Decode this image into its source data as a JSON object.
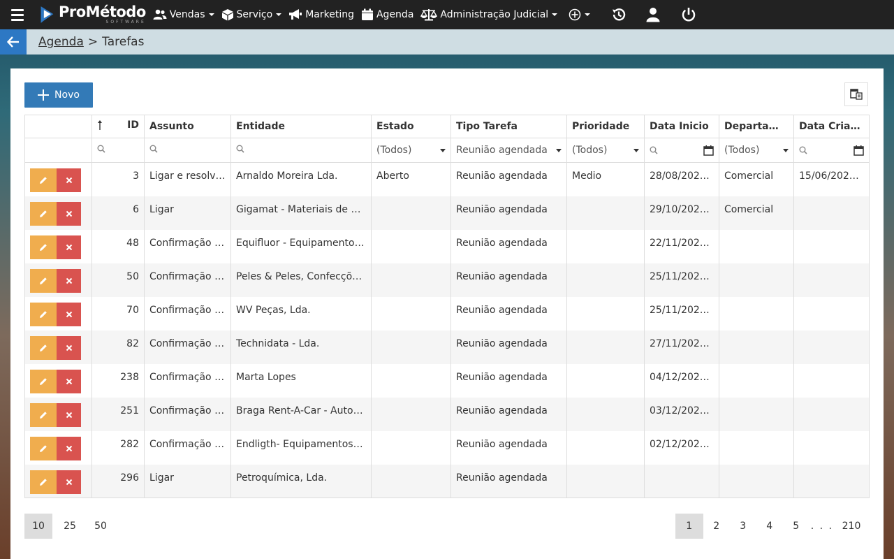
{
  "nav": {
    "logo_name": "ProMétodo",
    "logo_sub": "SOFTWARE",
    "items": [
      {
        "label": "Vendas"
      },
      {
        "label": "Serviço"
      },
      {
        "label": "Marketing"
      },
      {
        "label": "Agenda"
      },
      {
        "label": "Administração Judicial"
      }
    ]
  },
  "breadcrumb": {
    "parent": "Agenda",
    "separator": ">",
    "current": "Tarefas"
  },
  "toolbar": {
    "new_label": "Novo"
  },
  "table": {
    "columns": [
      "ID",
      "Assunto",
      "Entidade",
      "Estado",
      "Tipo Tarefa",
      "Prioridade",
      "Data Inicio",
      "Departamento",
      "Data Criação"
    ],
    "filters": {
      "estado": "(Todos)",
      "tipo_tarefa": "Reunião agendada",
      "prioridade": "(Todos)",
      "departamento": "(Todos)"
    },
    "rows": [
      {
        "id": "3",
        "assunto": "Ligar e resolver ...",
        "entidade": "Arnaldo Moreira Lda.",
        "estado": "Aberto",
        "tipo": "Reunião agendada",
        "prioridade": "Medio",
        "inicio": "28/08/2023 ...",
        "departamento": "Comercial",
        "criacao": "15/06/2023 ..."
      },
      {
        "id": "6",
        "assunto": "Ligar",
        "entidade": "Gigamat - Materiais de Con...",
        "estado": "",
        "tipo": "Reunião agendada",
        "prioridade": "",
        "inicio": "29/10/2024 ...",
        "departamento": "Comercial",
        "criacao": ""
      },
      {
        "id": "48",
        "assunto": "Confirmação de...",
        "entidade": "Equifluor - Equipamentos e ...",
        "estado": "",
        "tipo": "Reunião agendada",
        "prioridade": "",
        "inicio": "22/11/2024 ...",
        "departamento": "",
        "criacao": ""
      },
      {
        "id": "50",
        "assunto": "Confirmação de...",
        "entidade": "Peles & Peles, Confecções, L...",
        "estado": "",
        "tipo": "Reunião agendada",
        "prioridade": "",
        "inicio": "25/11/2024 ...",
        "departamento": "",
        "criacao": ""
      },
      {
        "id": "70",
        "assunto": "Confirmação de...",
        "entidade": "WV Peças, Lda.",
        "estado": "",
        "tipo": "Reunião agendada",
        "prioridade": "",
        "inicio": "25/11/2024 ...",
        "departamento": "",
        "criacao": ""
      },
      {
        "id": "82",
        "assunto": "Confirmação de...",
        "entidade": "Technidata - Lda.",
        "estado": "",
        "tipo": "Reunião agendada",
        "prioridade": "",
        "inicio": "27/11/2023 ...",
        "departamento": "",
        "criacao": ""
      },
      {
        "id": "238",
        "assunto": "Confirmação de...",
        "entidade": "Marta Lopes",
        "estado": "",
        "tipo": "Reunião agendada",
        "prioridade": "",
        "inicio": "04/12/2025 ...",
        "departamento": "",
        "criacao": ""
      },
      {
        "id": "251",
        "assunto": "Confirmação de...",
        "entidade": "Braga Rent-A-Car - Automó...",
        "estado": "",
        "tipo": "Reunião agendada",
        "prioridade": "",
        "inicio": "03/12/2024 ...",
        "departamento": "",
        "criacao": ""
      },
      {
        "id": "282",
        "assunto": "Confirmação de...",
        "entidade": "Endligth- Equipamentos Ind...",
        "estado": "",
        "tipo": "Reunião agendada",
        "prioridade": "",
        "inicio": "02/12/2024 ...",
        "departamento": "",
        "criacao": ""
      },
      {
        "id": "296",
        "assunto": "Ligar",
        "entidade": "Petroquímica, Lda.",
        "estado": "",
        "tipo": "Reunião agendada",
        "prioridade": "",
        "inicio": "",
        "departamento": "",
        "criacao": ""
      }
    ]
  },
  "pagination": {
    "page_sizes": [
      "10",
      "25",
      "50"
    ],
    "active_size": "10",
    "pages": [
      "1",
      "2",
      "3",
      "4",
      "5"
    ],
    "active_page": "1",
    "ellipsis": ". . .",
    "last_page": "210"
  },
  "colors": {
    "primary": "#337ab7",
    "edit": "#f0ad4e",
    "delete": "#d9534f",
    "navbar": "#222222"
  }
}
